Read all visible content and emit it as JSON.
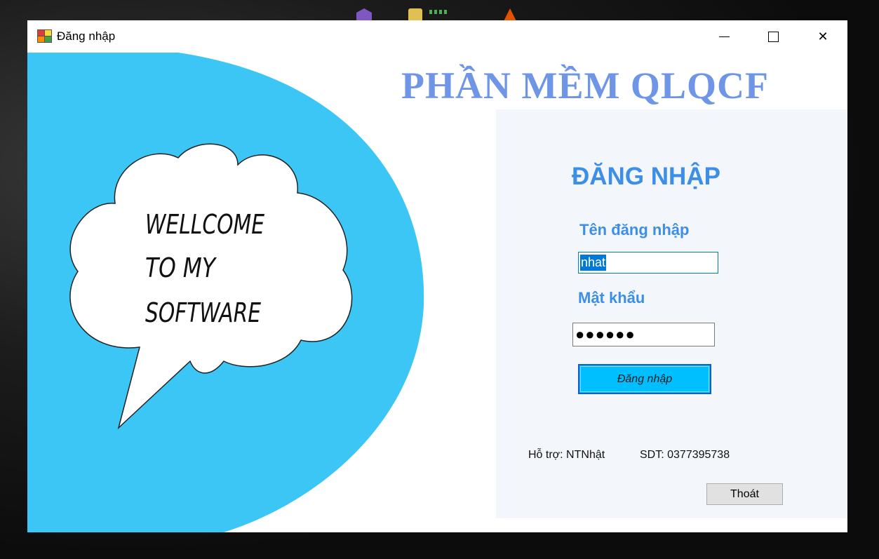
{
  "window": {
    "title": "Đăng nhập",
    "controls": {
      "minimize_icon": "minimize-icon",
      "maximize_icon": "maximize-icon",
      "close_icon": "close-icon",
      "close_glyph": "✕"
    }
  },
  "app": {
    "title": "PHẦN MỀM QLQCF"
  },
  "welcome": {
    "line1": "WELLCOME",
    "line2": "TO MY",
    "line3": "SOFTWARE"
  },
  "login": {
    "heading": "ĐĂNG NHẬP",
    "username_label": "Tên đăng nhập",
    "username_value": "nhat",
    "password_label": "Mật khẩu",
    "password_value": "●●●●●●",
    "submit_label": "Đăng nhập",
    "support": "Hỗ trợ: NTNhật",
    "phone": "SDT: 0377395738",
    "exit_label": "Thoát"
  },
  "colors": {
    "accent_blue": "#3d8fe6",
    "title_blue": "#6f96e6",
    "panel_cyan": "#3cc6f6",
    "login_button": "#00bfff"
  }
}
